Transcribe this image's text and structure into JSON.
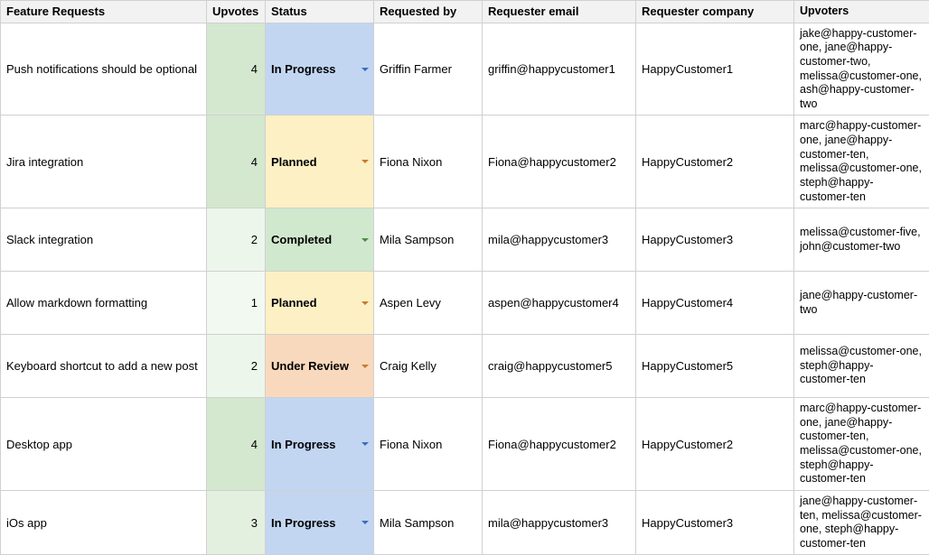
{
  "headers": {
    "feature": "Feature Requests",
    "upvotes": "Upvotes",
    "status": "Status",
    "requested_by": "Requested by",
    "requester_email": "Requester email",
    "requester_company": "Requester company",
    "upvoters": "Upvoters"
  },
  "status_styles": {
    "In Progress": {
      "cell": "st-inprogress",
      "caret": "caret-blue"
    },
    "Planned": {
      "cell": "st-planned",
      "caret": "caret-orange"
    },
    "Completed": {
      "cell": "st-completed",
      "caret": "caret-green"
    },
    "Under Review": {
      "cell": "st-underreview",
      "caret": "caret-orange"
    }
  },
  "upvote_styles": {
    "1": "upv-1",
    "2": "upv-2",
    "3": "upv-3",
    "4": "upv-4"
  },
  "rows": [
    {
      "feature": "Push notifications should be optional",
      "upvotes": 4,
      "status": "In Progress",
      "requested_by": "Griffin Farmer",
      "requester_email": "griffin@happycustomer1",
      "requester_company": "HappyCustomer1",
      "upvoters": "jake@happy-customer-one, jane@happy-customer-two, melissa@customer-one, ash@happy-customer-two"
    },
    {
      "feature": "Jira integration",
      "upvotes": 4,
      "status": "Planned",
      "requested_by": "Fiona Nixon",
      "requester_email": "Fiona@happycustomer2",
      "requester_company": "HappyCustomer2",
      "upvoters": "marc@happy-customer-one, jane@happy-customer-ten, melissa@customer-one, steph@happy-customer-ten"
    },
    {
      "feature": "Slack integration",
      "upvotes": 2,
      "status": "Completed",
      "requested_by": "Mila Sampson",
      "requester_email": "mila@happycustomer3",
      "requester_company": "HappyCustomer3",
      "upvoters": "melissa@customer-five, john@customer-two"
    },
    {
      "feature": "Allow markdown formatting",
      "upvotes": 1,
      "status": "Planned",
      "requested_by": "Aspen Levy",
      "requester_email": "aspen@happycustomer4",
      "requester_company": "HappyCustomer4",
      "upvoters": "jane@happy-customer-two"
    },
    {
      "feature": "Keyboard shortcut to add a new post",
      "upvotes": 2,
      "status": "Under Review",
      "requested_by": "Craig Kelly",
      "requester_email": "craig@happycustomer5",
      "requester_company": "HappyCustomer5",
      "upvoters": "melissa@customer-one, steph@happy-customer-ten"
    },
    {
      "feature": "Desktop app",
      "upvotes": 4,
      "status": "In Progress",
      "requested_by": "Fiona Nixon",
      "requester_email": "Fiona@happycustomer2",
      "requester_company": "HappyCustomer2",
      "upvoters": "marc@happy-customer-one, jane@happy-customer-ten, melissa@customer-one, steph@happy-customer-ten"
    },
    {
      "feature": "iOs app",
      "upvotes": 3,
      "status": "In Progress",
      "requested_by": "Mila Sampson",
      "requester_email": "mila@happycustomer3",
      "requester_company": "HappyCustomer3",
      "upvoters": "jane@happy-customer-ten, melissa@customer-one, steph@happy-customer-ten"
    }
  ]
}
